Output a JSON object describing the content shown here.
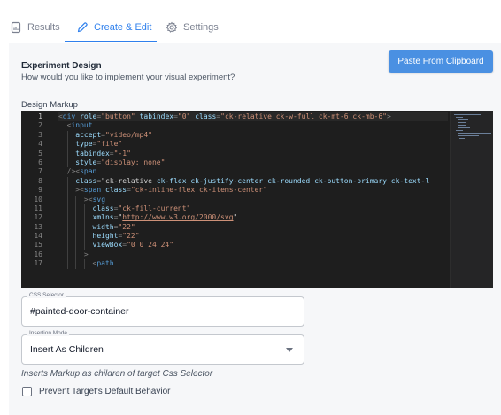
{
  "tabs": [
    {
      "label": "Results",
      "icon": "results-doc-icon",
      "active": false
    },
    {
      "label": "Create & Edit",
      "icon": "pencil-icon",
      "active": true
    },
    {
      "label": "Settings",
      "icon": "gear-icon",
      "active": false
    }
  ],
  "experiment": {
    "title": "Experiment Design",
    "subtitle": "How would you like to implement your visual experiment?",
    "paste_button": "Paste From Clipboard"
  },
  "markup": {
    "label": "Design Markup",
    "active_line": 1,
    "lines": [
      "<div role=\"button\" tabindex=\"0\" class=\"ck-relative ck-w-full ck-mt-6 ck-mb-6\">",
      "  <input",
      "    accept=\"video/mp4\"",
      "    type=\"file\"",
      "    tabindex=\"-1\"",
      "    style=\"display: none\"",
      "  /><span",
      "    class=\"ck-relative ck-flex ck-justify-center ck-rounded ck-button-primary ck-text-l",
      "    ><span class=\"ck-inline-flex ck-items-center\"",
      "      ><svg",
      "        class=\"ck-fill-current\"",
      "        xmlns=\"http://www.w3.org/2000/svg\"",
      "        width=\"22\"",
      "        height=\"22\"",
      "        viewBox=\"0 0 24 24\"",
      "      >",
      "        <path"
    ]
  },
  "css_selector": {
    "label": "CSS Selector",
    "value": "#painted-door-container"
  },
  "insertion_mode": {
    "label": "Insertion Mode",
    "value": "Insert As Children",
    "hint": "Inserts Markup as children of target Css Selector"
  },
  "prevent_default": {
    "label": "Prevent Target's Default Behavior",
    "checked": false
  },
  "colors": {
    "accent": "#2f80ed",
    "button": "#4a90e2",
    "editor_bg": "#1e1e1e"
  }
}
